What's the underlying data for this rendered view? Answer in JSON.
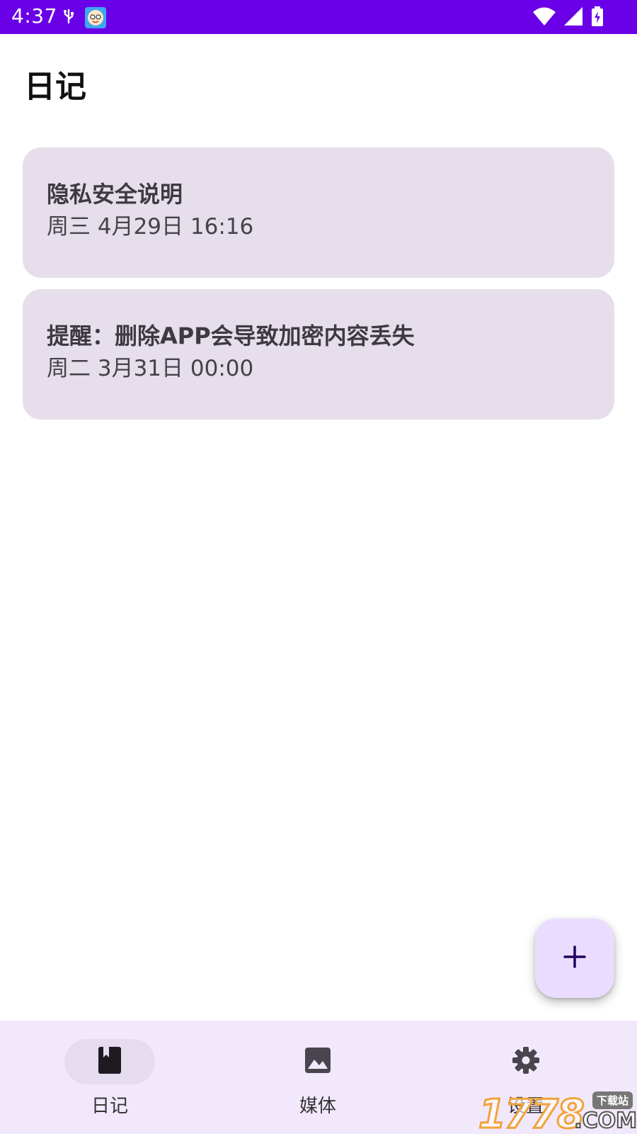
{
  "status_bar": {
    "time": "4:37",
    "icons": [
      "usb-debug-icon",
      "app-notification-icon",
      "wifi-icon",
      "cell-signal-icon",
      "battery-charging-icon"
    ]
  },
  "header": {
    "title": "日记"
  },
  "entries": [
    {
      "title": "隐私安全说明",
      "date": "周三 4月29日 16:16"
    },
    {
      "title": "提醒：删除APP会导致加密内容丢失",
      "date": "周二 3月31日 00:00"
    }
  ],
  "fab": {
    "icon": "plus-icon"
  },
  "bottom_nav": {
    "items": [
      {
        "label": "日记",
        "icon": "diary-book-icon",
        "active": true
      },
      {
        "label": "媒体",
        "icon": "image-icon",
        "active": false
      },
      {
        "label": "设置",
        "icon": "gear-icon",
        "active": false
      }
    ]
  },
  "watermark": {
    "number": "1778",
    "badge": "下载站",
    "suffix": ".COM"
  },
  "colors": {
    "status_bar": "#6a00e8",
    "card_bg": "#e6dfeb",
    "fab_bg": "#eadcff",
    "nav_bg": "#f2e8fc",
    "nav_active_pill": "#e6dcf0"
  }
}
